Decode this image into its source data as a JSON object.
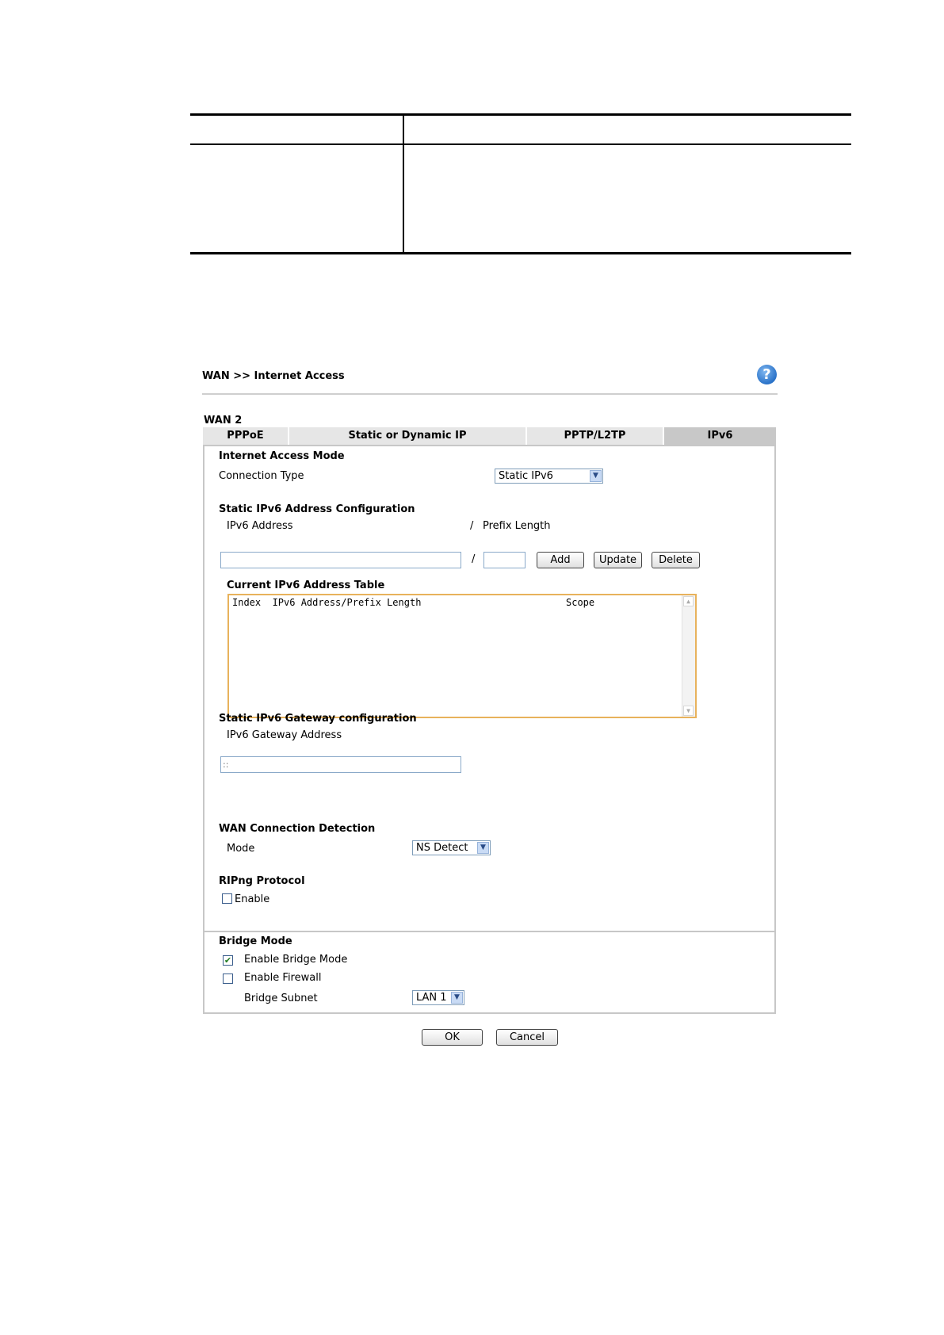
{
  "page": {
    "title": "WAN >> Internet Access",
    "help_icon": "?",
    "wan_label": "WAN 2"
  },
  "tabs": [
    {
      "label": "PPPoE",
      "active": false
    },
    {
      "label": "Static or Dynamic IP",
      "active": false
    },
    {
      "label": "PPTP/L2TP",
      "active": false
    },
    {
      "label": "IPv6",
      "active": true
    }
  ],
  "internet_access_mode": {
    "heading": "Internet Access Mode",
    "connection_type_label": "Connection Type",
    "connection_type_value": "Static IPv6"
  },
  "static_ipv6": {
    "heading": "Static IPv6 Address Configuration",
    "ipv6_address_label": "IPv6 Address",
    "slash": "/",
    "prefix_length_label": "Prefix Length",
    "address_value": "",
    "prefix_value": "",
    "add_label": "Add",
    "update_label": "Update",
    "delete_label": "Delete"
  },
  "address_table": {
    "heading": "Current IPv6 Address Table",
    "columns_left": "Index  IPv6 Address/Prefix Length",
    "column_scope": "Scope"
  },
  "gateway": {
    "heading": "Static IPv6 Gateway configuration",
    "label": "IPv6 Gateway Address",
    "value": "::"
  },
  "detection": {
    "heading": "WAN Connection Detection",
    "mode_label": "Mode",
    "mode_value": "NS Detect"
  },
  "ripng": {
    "heading": "RIPng Protocol",
    "enable_label": "Enable",
    "enabled": false
  },
  "bridge": {
    "heading": "Bridge Mode",
    "enable_bridge_label": "Enable Bridge Mode",
    "enable_bridge_checked": true,
    "enable_firewall_label": "Enable Firewall",
    "enable_firewall_checked": false,
    "subnet_label": "Bridge Subnet",
    "subnet_value": "LAN 1"
  },
  "actions": {
    "ok_label": "OK",
    "cancel_label": "Cancel"
  },
  "icons": {
    "dropdown": "chevron-down-icon",
    "check": "✔"
  }
}
